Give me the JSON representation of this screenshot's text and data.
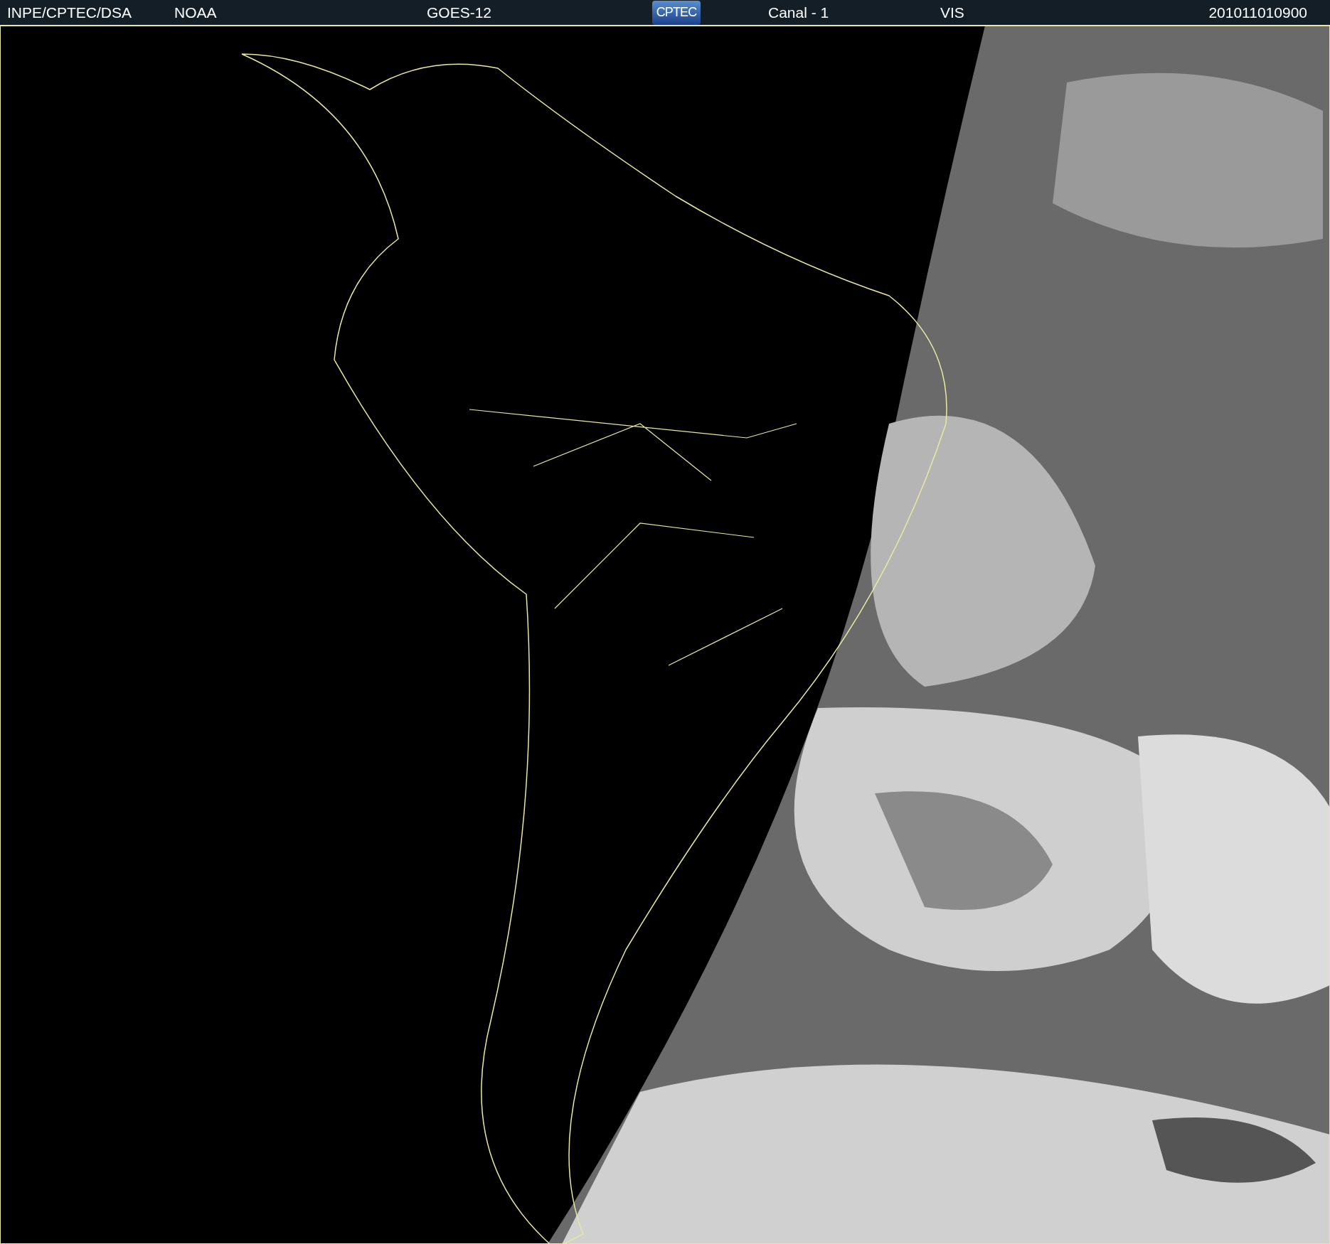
{
  "header": {
    "source": "INPE/CPTEC/DSA",
    "agency": "NOAA",
    "satellite": "GOES-12",
    "logo": "CPTEC",
    "channel": "Canal - 1",
    "band": "VIS",
    "timestamp": "201011010900"
  }
}
